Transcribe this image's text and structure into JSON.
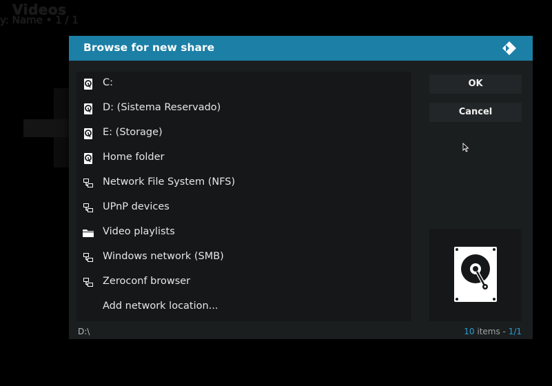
{
  "background": {
    "title": "Videos",
    "sort": "y: Name • 1 / 1"
  },
  "dialog": {
    "title": "Browse for new share",
    "logo_icon": "kodi-logo-icon"
  },
  "sources": [
    {
      "label": "C:",
      "icon": "hard-drive-icon"
    },
    {
      "label": "D: (Sistema Reservado)",
      "icon": "hard-drive-icon"
    },
    {
      "label": "E: (Storage)",
      "icon": "hard-drive-icon"
    },
    {
      "label": "Home folder",
      "icon": "hard-drive-icon"
    },
    {
      "label": "Network File System (NFS)",
      "icon": "network-icon"
    },
    {
      "label": "UPnP devices",
      "icon": "network-icon"
    },
    {
      "label": "Video playlists",
      "icon": "folder-icon"
    },
    {
      "label": "Windows network (SMB)",
      "icon": "network-icon"
    },
    {
      "label": "Zeroconf browser",
      "icon": "network-icon"
    },
    {
      "label": "Add network location...",
      "icon": ""
    }
  ],
  "buttons": {
    "ok": "OK",
    "cancel": "Cancel"
  },
  "preview": {
    "icon": "hard-drive-icon"
  },
  "footer": {
    "path": "D:\\",
    "count": "10",
    "items_word": " items - ",
    "page": "1/1"
  },
  "colors": {
    "accent": "#1c7fa6",
    "highlight_text": "#2a9ed2",
    "dialog_bg": "#1b1e1f",
    "list_bg": "#151718"
  }
}
